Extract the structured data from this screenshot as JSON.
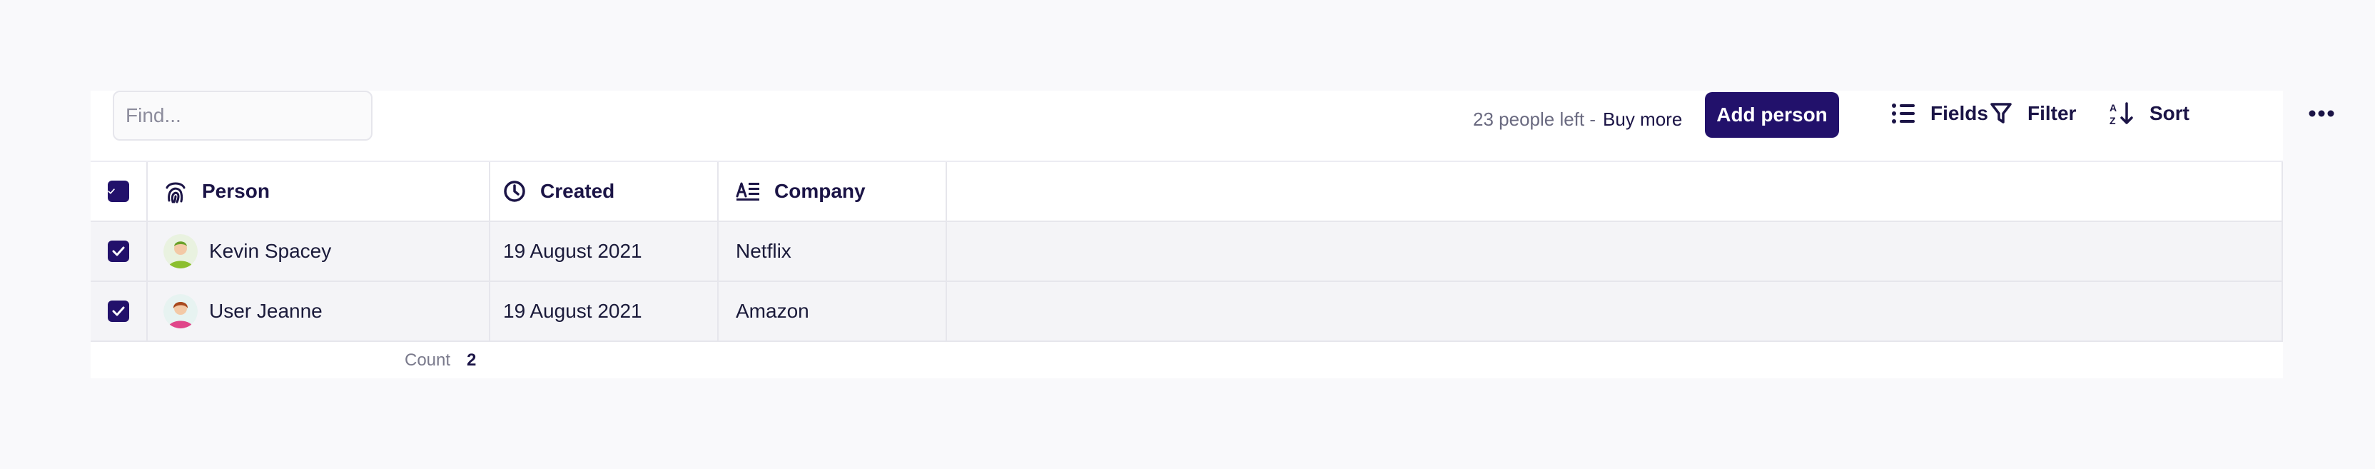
{
  "toolbar": {
    "search_placeholder": "Find...",
    "quota_text": "23 people left -",
    "buy_more_label": "Buy more",
    "add_person_label": "Add person",
    "fields_label": "Fields",
    "filter_label": "Filter",
    "sort_label": "Sort",
    "more_icon": "more-horizontal-icon"
  },
  "table": {
    "columns": [
      {
        "label": "Person",
        "icon": "fingerprint-icon"
      },
      {
        "label": "Created",
        "icon": "clock-icon"
      },
      {
        "label": "Company",
        "icon": "text-align-icon"
      }
    ],
    "rows": [
      {
        "person": "Kevin Spacey",
        "created": "19 August 2021",
        "company": "Netflix",
        "checked": true
      },
      {
        "person": "User Jeanne",
        "created": "19 August 2021",
        "company": "Amazon",
        "checked": true
      }
    ],
    "header_checked": true
  },
  "footer": {
    "count_label": "Count",
    "count_value": "2"
  },
  "colors": {
    "accent": "#22116b",
    "page_bg": "#f9f9fb",
    "row_bg": "#f4f4f7",
    "border": "#e6e6ec"
  }
}
